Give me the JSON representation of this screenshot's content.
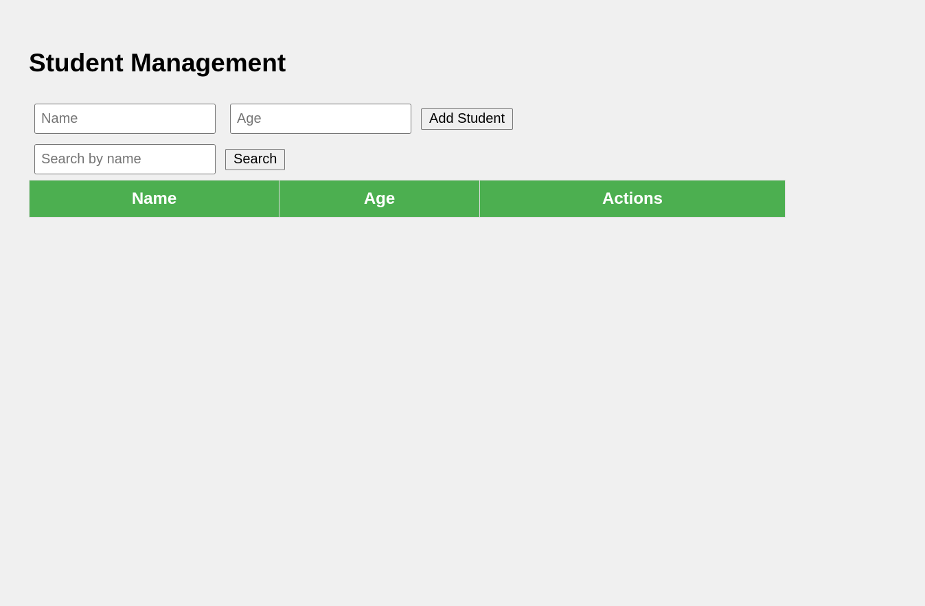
{
  "page": {
    "title": "Student Management"
  },
  "form": {
    "name_placeholder": "Name",
    "name_value": "",
    "age_placeholder": "Age",
    "age_value": "",
    "add_button_label": "Add Student"
  },
  "search": {
    "placeholder": "Search by name",
    "value": "",
    "button_label": "Search"
  },
  "table": {
    "columns": [
      "Name",
      "Age",
      "Actions"
    ],
    "rows": []
  },
  "colors": {
    "background": "#f0f0f0",
    "header_bg": "#4caf50",
    "header_text": "#ffffff"
  }
}
